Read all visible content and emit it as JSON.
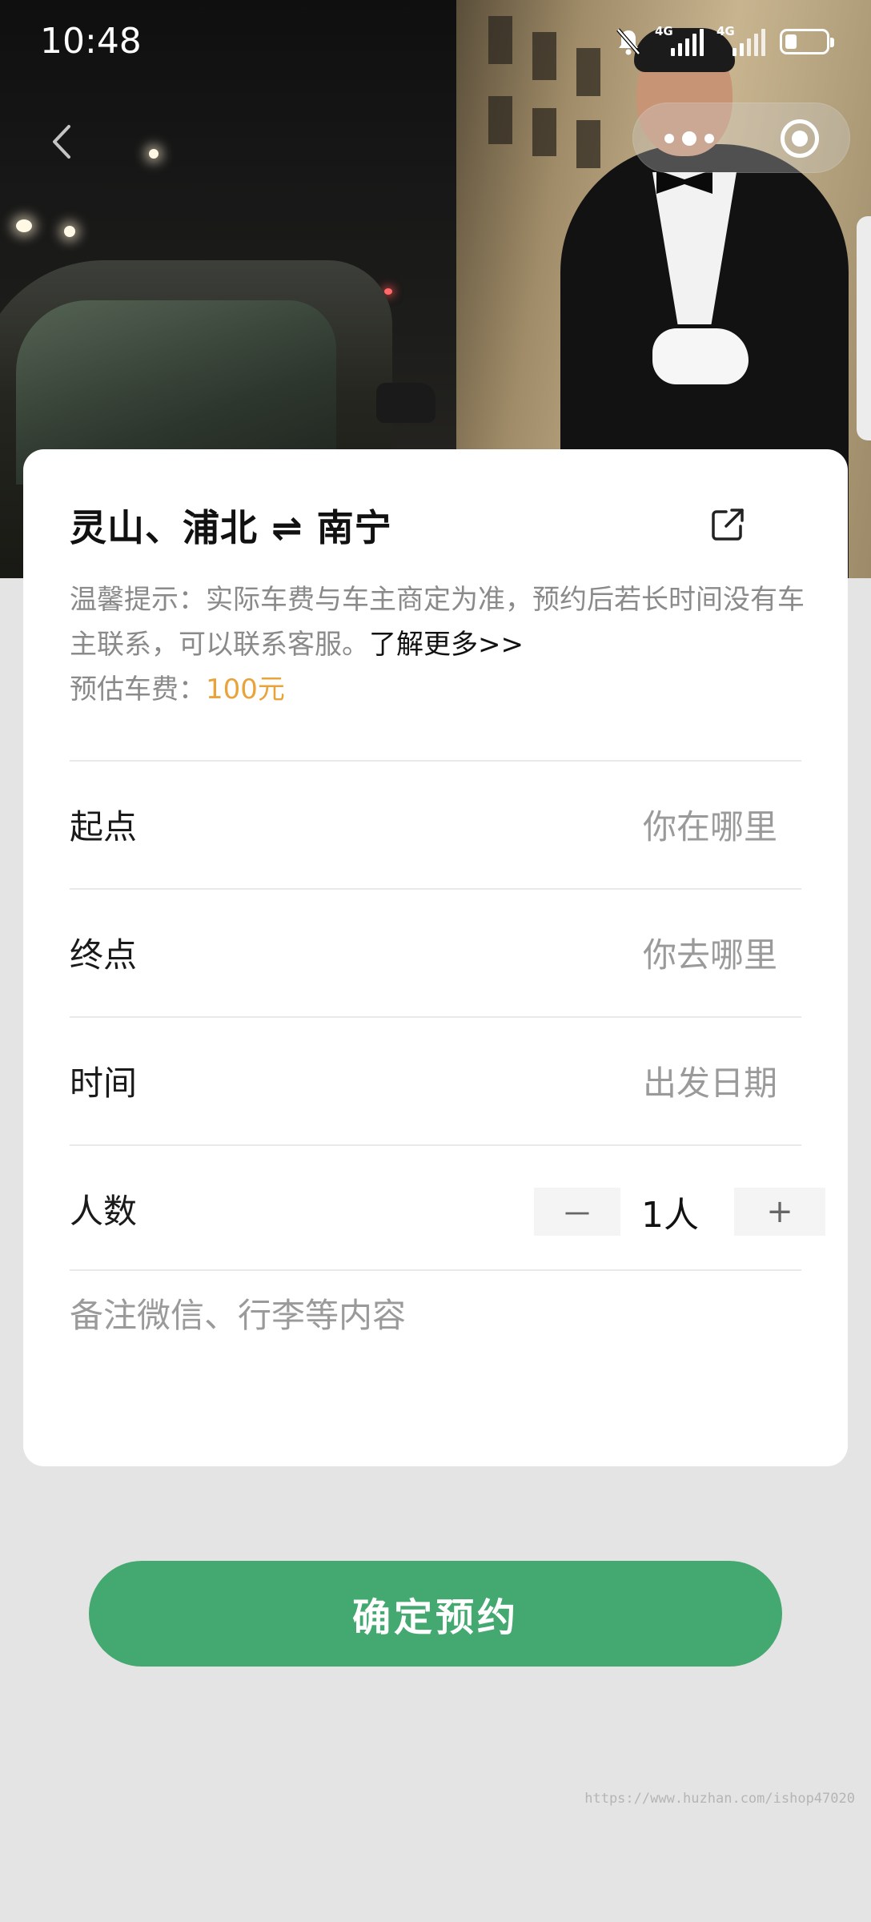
{
  "status_bar": {
    "time": "10:48",
    "network_1": "4G",
    "network_2": "4G",
    "icons": [
      "mute-bell-icon",
      "signal-icon",
      "signal-icon",
      "battery-icon"
    ]
  },
  "nav": {
    "back_icon": "chevron-left-icon",
    "more_icon": "more-dots-icon",
    "close_icon": "target-close-icon"
  },
  "card": {
    "route_title": "灵山、浦北 ⇌ 南宁",
    "share_icon": "external-link-icon",
    "notice_text": "温馨提示：实际车费与车主商定为准，预约后若长时间没有车主联系，可以联系客服。",
    "notice_more": "了解更多>>",
    "fare_label": "预估车费：",
    "fare_amount": "100元",
    "fields": {
      "origin": {
        "label": "起点",
        "placeholder": "你在哪里"
      },
      "destination": {
        "label": "终点",
        "placeholder": "你去哪里"
      },
      "time": {
        "label": "时间",
        "placeholder": "出发日期"
      },
      "passengers": {
        "label": "人数",
        "decrement": "－",
        "value": "1人",
        "increment": "+"
      }
    },
    "remark_placeholder": "备注微信、行李等内容"
  },
  "confirm_button": "确定预约",
  "watermark": "https://www.huzhan.com/ishop47020",
  "colors": {
    "accent_green": "#44a971",
    "fare_orange": "#e8a43a",
    "page_background": "#e4e4e4"
  }
}
